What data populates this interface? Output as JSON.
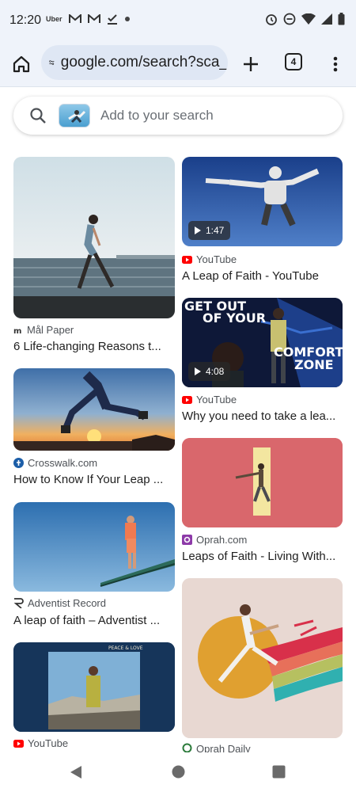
{
  "status": {
    "time": "12:20",
    "uber": "Uber"
  },
  "browser": {
    "url": "google.com/search?sca_",
    "tab_count": "4"
  },
  "search": {
    "placeholder": "Add to your search"
  },
  "results_left": [
    {
      "source": "Mål Paper",
      "title": "6 Life-changing Reasons t..."
    },
    {
      "source": "Crosswalk.com",
      "title": "How to Know If Your Leap ..."
    },
    {
      "source": "Adventist Record",
      "title": "A leap of faith – Adventist ..."
    },
    {
      "source": "YouTube",
      "title": "",
      "album_text": "PEACE & LOVE"
    }
  ],
  "results_right": [
    {
      "source": "YouTube",
      "title": "A Leap of Faith - YouTube",
      "duration": "1:47"
    },
    {
      "source": "YouTube",
      "title": "Why you need to take a lea...",
      "duration": "4:08",
      "overlay_line1": "GET OUT",
      "overlay_line2": "OF YOUR",
      "overlay_line3": "COMFORT",
      "overlay_line4": "ZONE"
    },
    {
      "source": "Oprah.com",
      "title": "Leaps of Faith - Living With..."
    },
    {
      "source": "Oprah Daily",
      "title": ""
    }
  ],
  "icons": {
    "home": "home-icon",
    "site_settings": "tune-icon",
    "new_tab": "plus-icon",
    "menu": "more-vert-icon",
    "search": "search-icon",
    "back": "back-triangle-icon",
    "home_nav": "home-circle-icon",
    "recents": "recents-square-icon"
  },
  "colors": {
    "youtube_red": "#ff0000",
    "oprah_purple": "#8d3aa8",
    "crosswalk_blue": "#1c5ea8",
    "toolbar_bg": "#eff3fa"
  }
}
